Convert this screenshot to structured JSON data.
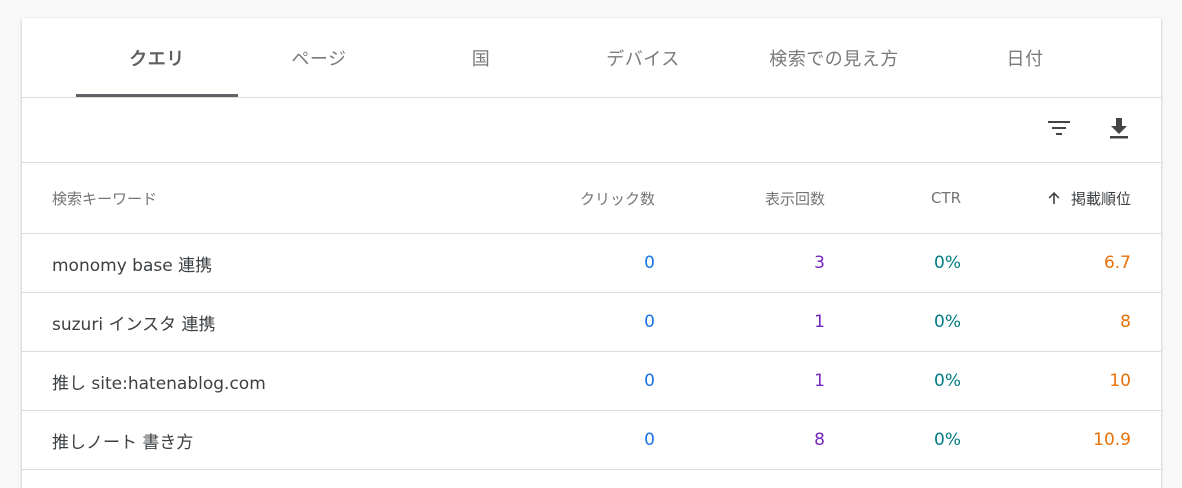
{
  "tabs": [
    {
      "label": "クエリ"
    },
    {
      "label": "ページ"
    },
    {
      "label": "国"
    },
    {
      "label": "デバイス"
    },
    {
      "label": "検索での見え方"
    },
    {
      "label": "日付"
    }
  ],
  "active_tab": "クエリ",
  "toolbar": {
    "filter_icon": "filter-list-icon",
    "download_icon": "download-icon"
  },
  "table": {
    "columns": {
      "keyword": "検索キーワード",
      "clicks": "クリック数",
      "impressions": "表示回数",
      "ctr": "CTR",
      "position": "掲載順位"
    },
    "sort": {
      "column": "position",
      "direction": "ascending"
    },
    "rows": [
      {
        "keyword": "monomy base 連携",
        "clicks": "0",
        "impressions": "3",
        "ctr": "0%",
        "position": "6.7"
      },
      {
        "keyword": "suzuri インスタ 連携",
        "clicks": "0",
        "impressions": "1",
        "ctr": "0%",
        "position": "8"
      },
      {
        "keyword": "推し site:hatenablog.com",
        "clicks": "0",
        "impressions": "1",
        "ctr": "0%",
        "position": "10"
      },
      {
        "keyword": "推しノート 書き方",
        "clicks": "0",
        "impressions": "8",
        "ctr": "0%",
        "position": "10.9"
      }
    ]
  },
  "colors": {
    "clicks": "#1a73e8",
    "impressions": "#7627bb",
    "ctr": "#007b83",
    "position": "#e8710a"
  }
}
